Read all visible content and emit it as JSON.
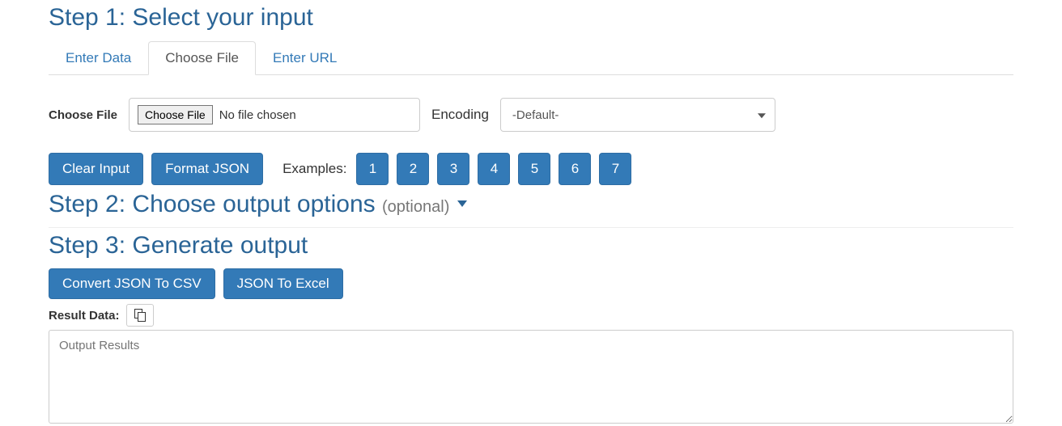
{
  "step1": {
    "heading": "Step 1: Select your input",
    "tabs": [
      "Enter Data",
      "Choose File",
      "Enter URL"
    ],
    "active_tab_index": 1,
    "choose_file_label": "Choose File",
    "native_button_label": "Choose File",
    "file_status": "No file chosen",
    "encoding_label": "Encoding",
    "encoding_value": "-Default-"
  },
  "actions": {
    "clear_label": "Clear Input",
    "format_label": "Format JSON",
    "examples_label": "Examples:",
    "examples": [
      "1",
      "2",
      "3",
      "4",
      "5",
      "6",
      "7"
    ]
  },
  "step2": {
    "heading": "Step 2: Choose output options ",
    "suffix": "(optional) "
  },
  "step3": {
    "heading": "Step 3: Generate output",
    "convert_label": "Convert JSON To CSV",
    "excel_label": "JSON To Excel",
    "result_label": "Result Data:",
    "output_placeholder": "Output Results"
  }
}
